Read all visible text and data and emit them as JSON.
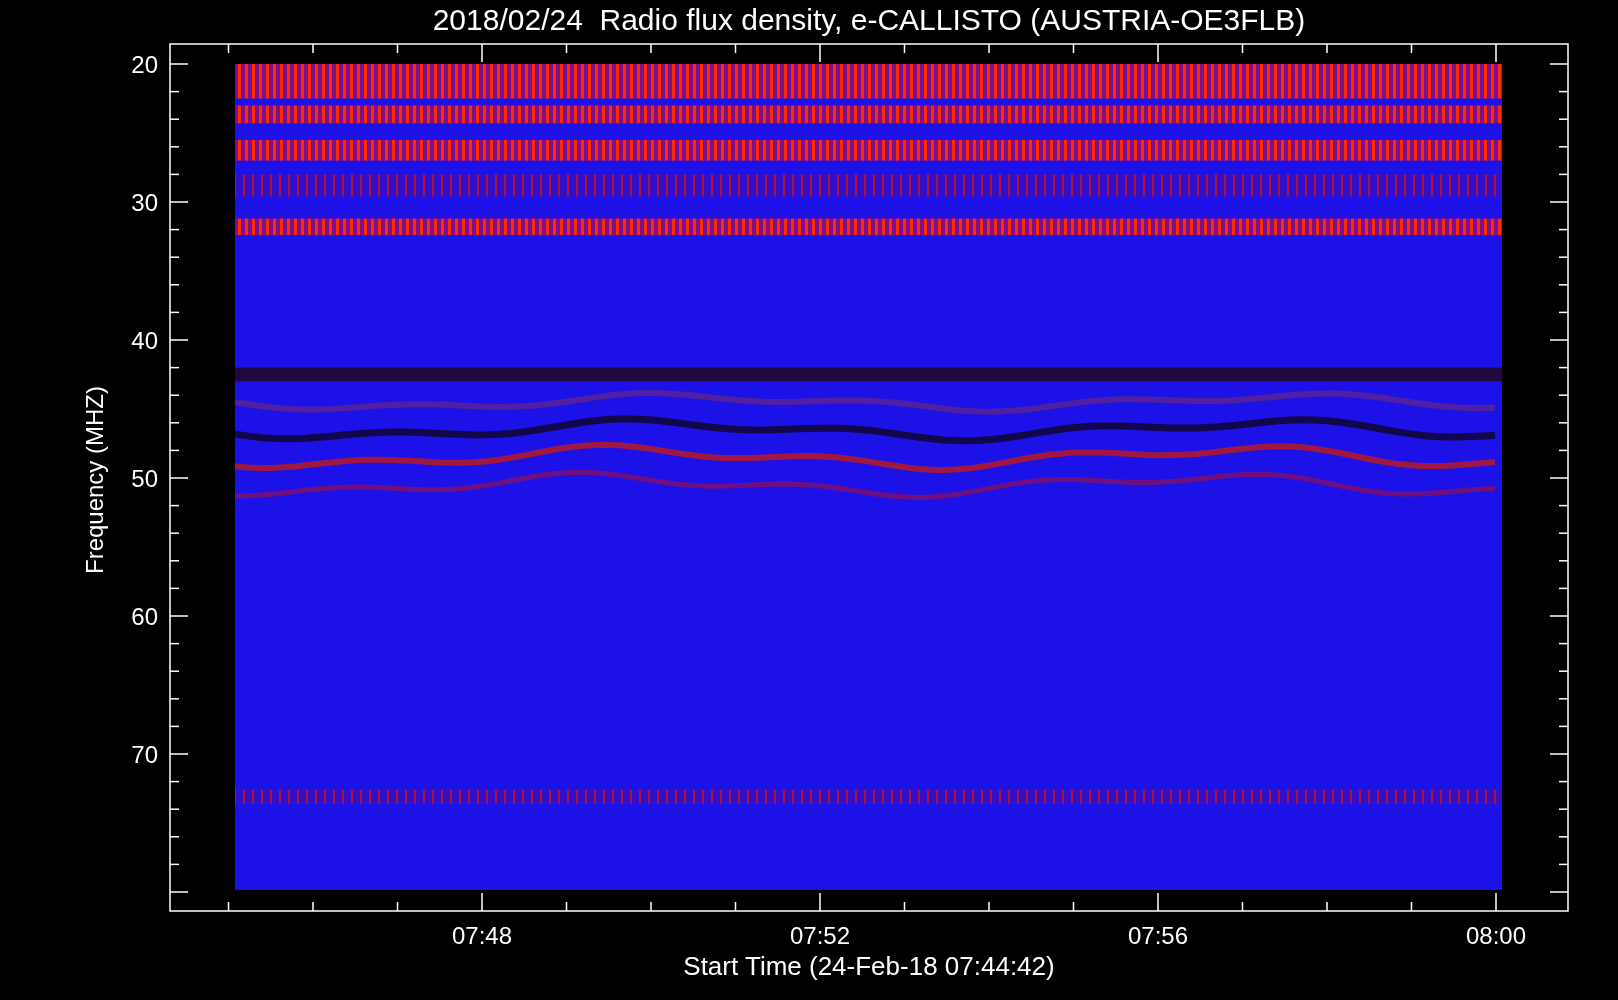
{
  "title": "2018/02/24  Radio flux density, e-CALLISTO (AUSTRIA-OE3FLB)",
  "y_axis": {
    "label": "Frequency (MHZ)",
    "ticks": [
      "20",
      "30",
      "40",
      "50",
      "60",
      "70"
    ]
  },
  "x_axis": {
    "label": "Start Time (24-Feb-18 07:44:42)",
    "ticks": [
      "07:48",
      "07:52",
      "07:56",
      "08:00"
    ]
  }
}
